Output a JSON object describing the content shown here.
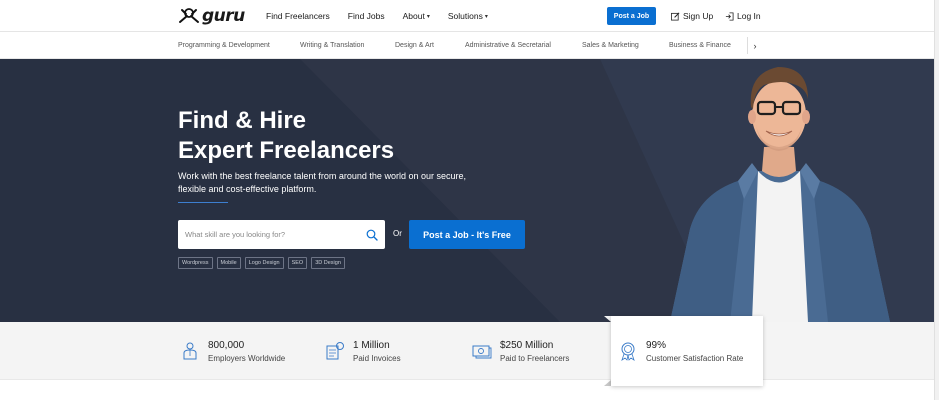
{
  "header": {
    "logo_text": "guru",
    "nav": [
      {
        "label": "Find Freelancers",
        "caret": false
      },
      {
        "label": "Find Jobs",
        "caret": false
      },
      {
        "label": "About",
        "caret": true
      },
      {
        "label": "Solutions",
        "caret": true
      }
    ],
    "post_job_label": "Post a Job",
    "signup_label": "Sign Up",
    "login_label": "Log In"
  },
  "categories": [
    "Programming & Development",
    "Writing & Translation",
    "Design & Art",
    "Administrative & Secretarial",
    "Sales & Marketing",
    "Business & Finance"
  ],
  "hero": {
    "title_line1": "Find & Hire",
    "title_line2": "Expert Freelancers",
    "subtitle": "Work with the best freelance talent from around the world on our secure, flexible and cost-effective platform.",
    "search_placeholder": "What skill are you looking for?",
    "or_text": "Or",
    "post_job_label": "Post a Job - It's Free",
    "tags": [
      "Wordpress",
      "Mobile",
      "Logo Design",
      "SEO",
      "3D Design"
    ]
  },
  "stats": [
    {
      "number": "800,000",
      "label": "Employers Worldwide",
      "icon": "employer-icon"
    },
    {
      "number": "1 Million",
      "label": "Paid Invoices",
      "icon": "invoice-icon"
    },
    {
      "number": "$250 Million",
      "label": "Paid to Freelancers",
      "icon": "money-icon"
    },
    {
      "number": "99%",
      "label": "Customer Satisfaction Rate",
      "icon": "award-icon"
    }
  ],
  "colors": {
    "brand_blue": "#0a6fd1",
    "hero_bg": "#2b3243",
    "stats_bg": "#f4f4f4"
  }
}
